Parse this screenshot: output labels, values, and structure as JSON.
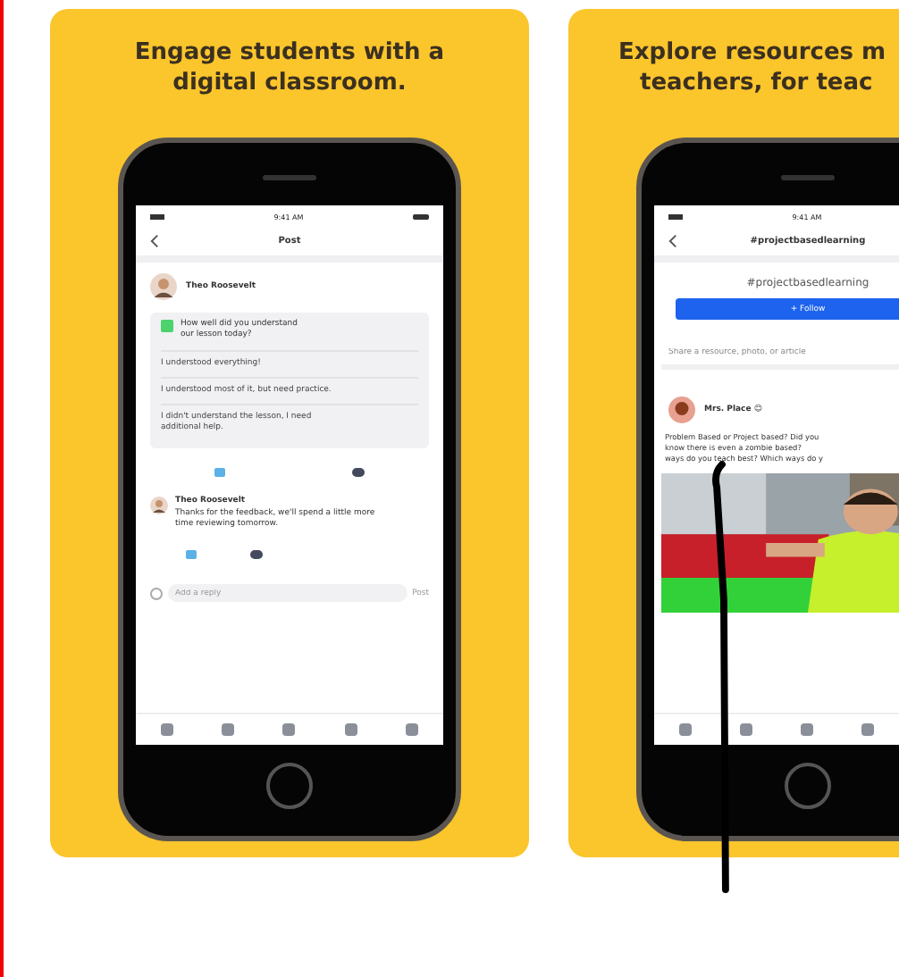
{
  "cards": [
    {
      "headline": [
        "Engage students with a",
        "digital classroom."
      ],
      "kind": "post",
      "status_time": "9:41 AM",
      "nav_title": "Post",
      "author": "Theo Roosevelt",
      "question": "How well did you understand our lesson today?",
      "options": [
        "I understood everything!",
        "I understood most of it, but need practice.",
        "I didn't understand the lesson, I need additional help."
      ],
      "reply_author": "Theo Roosevelt",
      "reply_text": "Thanks for the feedback, we'll spend a little more time reviewing tomorrow.",
      "reply_placeholder": "Add a reply",
      "send": "Post"
    },
    {
      "headline": [
        "Explore resources m",
        "teachers, for teac"
      ],
      "kind": "tag",
      "status_time": "9:41 AM",
      "nav_title": "#projectbasedlearning",
      "tag": "#projectbasedlearning",
      "follow": "+ Follow",
      "share_placeholder": "Share a resource, photo, or article",
      "author": "Mrs. Place 😊",
      "post_text": [
        "Problem Based or Project based? Did you",
        "know there is even a zombie based?",
        "ways do you teach best? Which ways do y"
      ]
    }
  ]
}
